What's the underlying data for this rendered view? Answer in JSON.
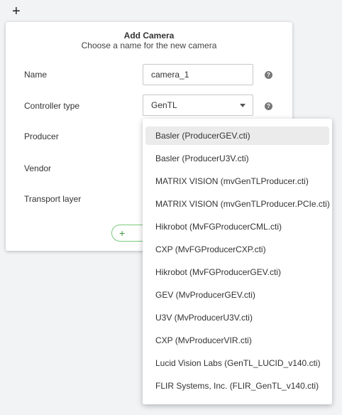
{
  "toolbar": {
    "add_icon": "+"
  },
  "dialog": {
    "title": "Add Camera",
    "subtitle": "Choose a name for the new camera",
    "fields": {
      "name_label": "Name",
      "name_value": "camera_1",
      "controller_label": "Controller type",
      "controller_value": "GenTL",
      "producer_label": "Producer",
      "vendor_label": "Vendor",
      "transport_label": "Transport layer"
    },
    "help_icon": "?",
    "add_button_icon": "+"
  },
  "dropdown": {
    "options": [
      "Basler (ProducerGEV.cti)",
      "Basler (ProducerU3V.cti)",
      "MATRIX VISION (mvGenTLProducer.cti)",
      "MATRIX VISION (mvGenTLProducer.PCIe.cti)",
      "Hikrobot (MvFGProducerCML.cti)",
      "CXP (MvFGProducerCXP.cti)",
      "Hikrobot (MvFGProducerGEV.cti)",
      "GEV (MvProducerGEV.cti)",
      "U3V (MvProducerU3V.cti)",
      "CXP (MvProducerVIR.cti)",
      "Lucid Vision Labs (GenTL_LUCID_v140.cti)",
      "FLIR Systems, Inc. (FLIR_GenTL_v140.cti)"
    ],
    "highlighted_index": 0
  }
}
